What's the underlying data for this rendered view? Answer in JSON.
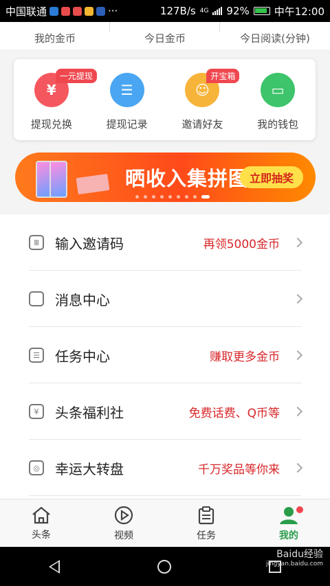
{
  "status_bar": {
    "carrier": "中国联通",
    "speed": "127B/s",
    "battery": "92%",
    "time": "中午12:00",
    "network": "4G"
  },
  "stats": [
    {
      "label": "我的金币"
    },
    {
      "label": "今日金币"
    },
    {
      "label": "今日阅读(分钟)"
    }
  ],
  "quick_actions": [
    {
      "label": "提现兑换",
      "badge": "一元提现",
      "icon": "yuan-icon",
      "color": "#f4585e",
      "glyph": "¥"
    },
    {
      "label": "提现记录",
      "badge": "",
      "icon": "record-icon",
      "color": "#4aa6f2",
      "glyph": "☰"
    },
    {
      "label": "邀请好友",
      "badge": "开宝箱",
      "icon": "invite-icon",
      "color": "#f7b43a",
      "glyph": "☺"
    },
    {
      "label": "我的钱包",
      "badge": "",
      "icon": "wallet-icon",
      "color": "#3ec46a",
      "glyph": "▭"
    }
  ],
  "banner": {
    "title": "晒收入集拼图",
    "button": "立即抽奖",
    "active_slide": 8,
    "slide_count": 9
  },
  "menu": [
    {
      "label": "输入邀请码",
      "extra": "再领5000金币",
      "icon": "invite-code-icon"
    },
    {
      "label": "消息中心",
      "extra": "",
      "icon": "message-icon"
    },
    {
      "label": "任务中心",
      "extra": "赚取更多金币",
      "icon": "task-icon"
    },
    {
      "label": "头条福利社",
      "extra": "免费话费、Q币等",
      "icon": "welfare-icon"
    },
    {
      "label": "幸运大转盘",
      "extra": "千万奖品等你来",
      "icon": "lucky-wheel-icon"
    }
  ],
  "tabs": [
    {
      "label": "头条",
      "icon": "home-icon"
    },
    {
      "label": "视频",
      "icon": "play-icon"
    },
    {
      "label": "任务",
      "icon": "clipboard-icon"
    },
    {
      "label": "我的",
      "icon": "user-icon"
    }
  ],
  "watermark": {
    "text": "Baidu经验",
    "sub": "jingyan.baidu.com"
  },
  "colors": {
    "accent": "#2a9d4a",
    "highlight_red": "#d8272a",
    "banner_orange": "#ff5a1a"
  }
}
